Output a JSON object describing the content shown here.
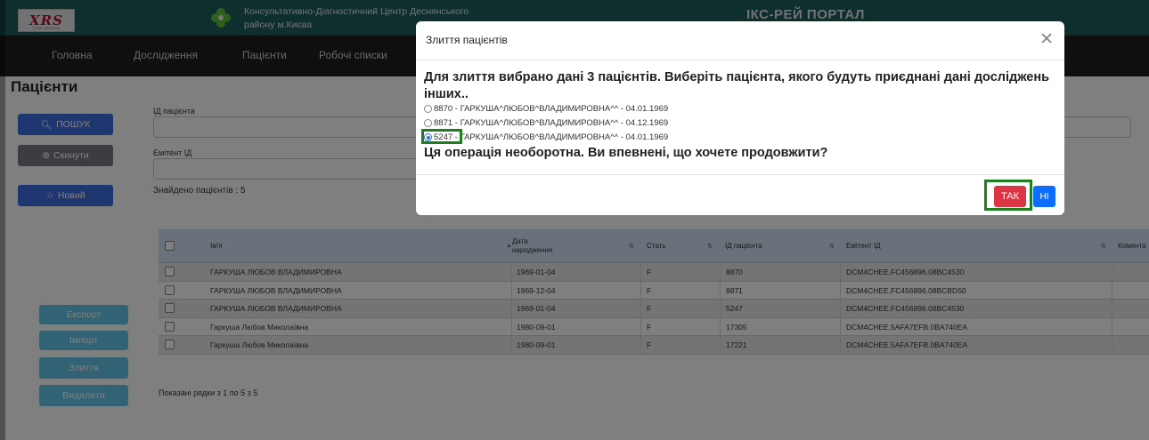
{
  "header": {
    "logo_text": "XRS",
    "logo_sub": "X-RAY SERVICE",
    "org_name_line1": "Консультативно-Діагностичний Центр Деснянського",
    "org_name_line2": "району м.Києва",
    "portal_title": "ІКС-РЕЙ ПОРТАЛ"
  },
  "nav": {
    "items": [
      "Головна",
      "Дослідження",
      "Пацієнти",
      "Робочі списки"
    ]
  },
  "page": {
    "title": "Пацієнти",
    "search_button": "ПОШУК",
    "reset_button": "Скинути",
    "new_button": "Новий",
    "patient_id_label": "ІД пацієнта",
    "issuer_id_label": "Емітент ІД",
    "found_text": "Знайдено пацієнтів : 5",
    "export_button": "Експорт",
    "import_button": "Імпорт",
    "merge_button": "Злиття",
    "delete_button": "Видалити",
    "shown_rows_text": "Показані рядки з 1 по 5 з 5"
  },
  "table": {
    "headers": [
      "Ім'я",
      "Дата народження",
      "Стать",
      "ІД пацієнта",
      "Емітент ІД",
      "Комента"
    ],
    "rows": [
      {
        "name": "ГАРКУША ЛЮБОВ ВЛАДИМИРОВНА",
        "dob": "1969-01-04",
        "sex": "F",
        "pid": "8870",
        "issuer": "DCM4CHEE.FC456896.08BC4530"
      },
      {
        "name": "ГАРКУША ЛЮБОВ ВЛАДИМИРОВНА",
        "dob": "1969-12-04",
        "sex": "F",
        "pid": "8871",
        "issuer": "DCM4CHEE.FC456896.08BCBD50"
      },
      {
        "name": "ГАРКУША ЛЮБОВ ВЛАДИМИРОВНА",
        "dob": "1969-01-04",
        "sex": "F",
        "pid": "5247",
        "issuer": "DCM4CHEE.FC456896.08BC4530"
      },
      {
        "name": "Гаркуша Любов Миколаївна",
        "dob": "1980-09-01",
        "sex": "F",
        "pid": "17305",
        "issuer": "DCM4CHEE.5AFA7EFB.0BA740EA"
      },
      {
        "name": "Гаркуша Любов Миколаївна",
        "dob": "1980-09-01",
        "sex": "F",
        "pid": "17221",
        "issuer": "DCM4CHEE.5AFA7EFB.0BA740EA"
      }
    ]
  },
  "modal": {
    "title": "Злиття пацієнтів",
    "question": "Для злиття вибрано дані 3 пацієнтів. Виберіть пацієнта, якого будуть приєднані дані досліджень інших..",
    "options": [
      {
        "id": "8870",
        "label": "8870 - ГАРКУША^ЛЮБОВ^ВЛАДИМИРОВНА^^ - 04.01.1969",
        "selected": false
      },
      {
        "id": "8871",
        "label": "8871 - ГАРКУША^ЛЮБОВ^ВЛАДИМИРОВНА^^ - 04.12.1969",
        "selected": false
      },
      {
        "id": "5247",
        "label": "5247 - ГАРКУША^ЛЮБОВ^ВЛАДИМИРОВНА^^ - 04.01.1969",
        "selected": true
      }
    ],
    "warning": "Ця операція необоротна. Ви впевнені, що хочете продовжити?",
    "yes_button": "ТАК",
    "no_button": "НІ"
  },
  "colors": {
    "header_bg": "#1f5f5f",
    "nav_bg": "#1f1f1f",
    "primary": "#3d6fe0",
    "danger": "#dc3545",
    "highlight": "#1f7f1f",
    "table_header_bg": "#d2e3f7"
  },
  "icons": {
    "search": "search-icon",
    "reset": "circle-x-icon",
    "new": "add-user-icon",
    "close": "close-icon"
  }
}
